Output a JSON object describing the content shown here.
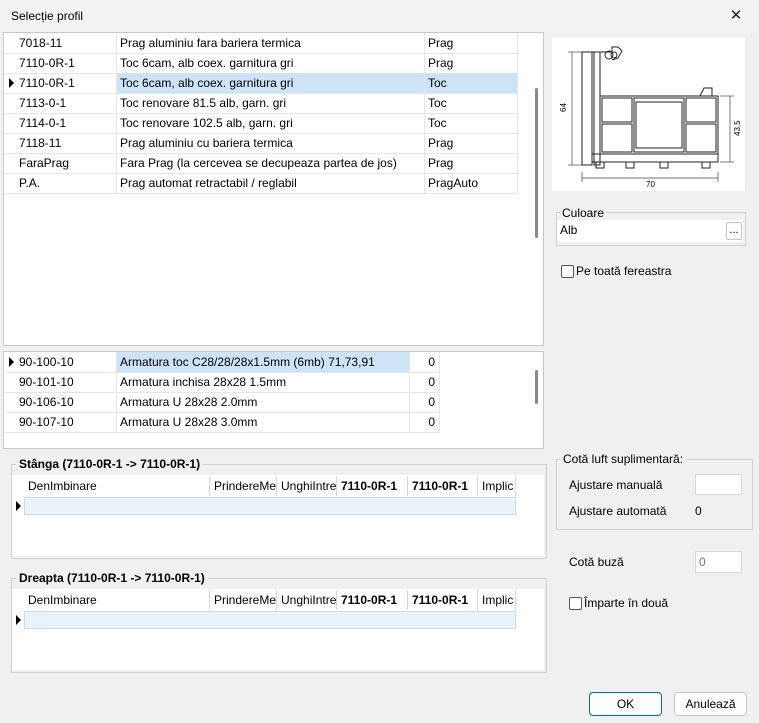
{
  "window": {
    "title": "Selecție profil",
    "close_glyph": "✕"
  },
  "profiles": {
    "rows": [
      {
        "code": "7018-11",
        "desc": "Prag aluminiu fara bariera termica",
        "type": "Prag"
      },
      {
        "code": "7110-0R-1",
        "desc": "Toc 6cam, alb coex. garnitura gri",
        "type": "Prag"
      },
      {
        "code": "7110-0R-1",
        "desc": "Toc 6cam, alb coex. garnitura gri",
        "type": "Toc"
      },
      {
        "code": "7113-0-1",
        "desc": "Toc renovare 81.5 alb, garn. gri",
        "type": "Toc"
      },
      {
        "code": "7114-0-1",
        "desc": "Toc renovare 102.5 alb, garn. gri",
        "type": "Toc"
      },
      {
        "code": "7118-11",
        "desc": "Prag aluminiu cu bariera termica",
        "type": "Prag"
      },
      {
        "code": "FaraPrag",
        "desc": "Fara Prag (la cercevea se decupeaza partea de jos)",
        "type": "Prag"
      },
      {
        "code": "P.A.",
        "desc": "Prag automat retractabil / reglabil",
        "type": "PragAuto"
      }
    ]
  },
  "reinforcements": {
    "rows": [
      {
        "code": "90-100-10",
        "desc": "Armatura toc C28/28/28x1.5mm (6mb) 71,73,91",
        "qty": "0"
      },
      {
        "code": "90-101-10",
        "desc": "Armatura inchisa 28x28 1.5mm",
        "qty": "0"
      },
      {
        "code": "90-106-10",
        "desc": "Armatura U 28x28 2.0mm",
        "qty": "0"
      },
      {
        "code": "90-107-10",
        "desc": "Armatura U 28x28 3.0mm",
        "qty": "0"
      }
    ]
  },
  "preview": {
    "dim_height": "64",
    "dim_width": "70",
    "dim_right": "43,5"
  },
  "culoare": {
    "label": "Culoare",
    "value": "Alb",
    "browse": "..."
  },
  "pe_toata": {
    "label": "Pe toată fereastra"
  },
  "stanga": {
    "title_word": "Stânga",
    "title_detail": "(7110-0R-1 -> 7110-0R-1)",
    "columns": [
      "DenImbinare",
      "PrindereMe",
      "UnghiIntre",
      "7110-0R-1",
      "7110-0R-1",
      "Implic"
    ]
  },
  "dreapta": {
    "title_word": "Dreapta",
    "title_detail": "(7110-0R-1 -> 7110-0R-1)",
    "columns": [
      "DenImbinare",
      "PrindereMe",
      "UnghiIntre",
      "7110-0R-1",
      "7110-0R-1",
      "Implic"
    ]
  },
  "cota_luft": {
    "title": "Cotă luft suplimentară:",
    "manual_label": "Ajustare manuală",
    "manual_value": "",
    "auto_label": "Ajustare automată",
    "auto_value": "0"
  },
  "cota_buza": {
    "label": "Cotă buză",
    "placeholder": "0"
  },
  "imparte": {
    "label": "Împarte în două"
  },
  "buttons": {
    "ok": "OK",
    "cancel": "Anulează"
  },
  "colors": {
    "selection": "#cde3f7",
    "accent": "#0067c0"
  }
}
